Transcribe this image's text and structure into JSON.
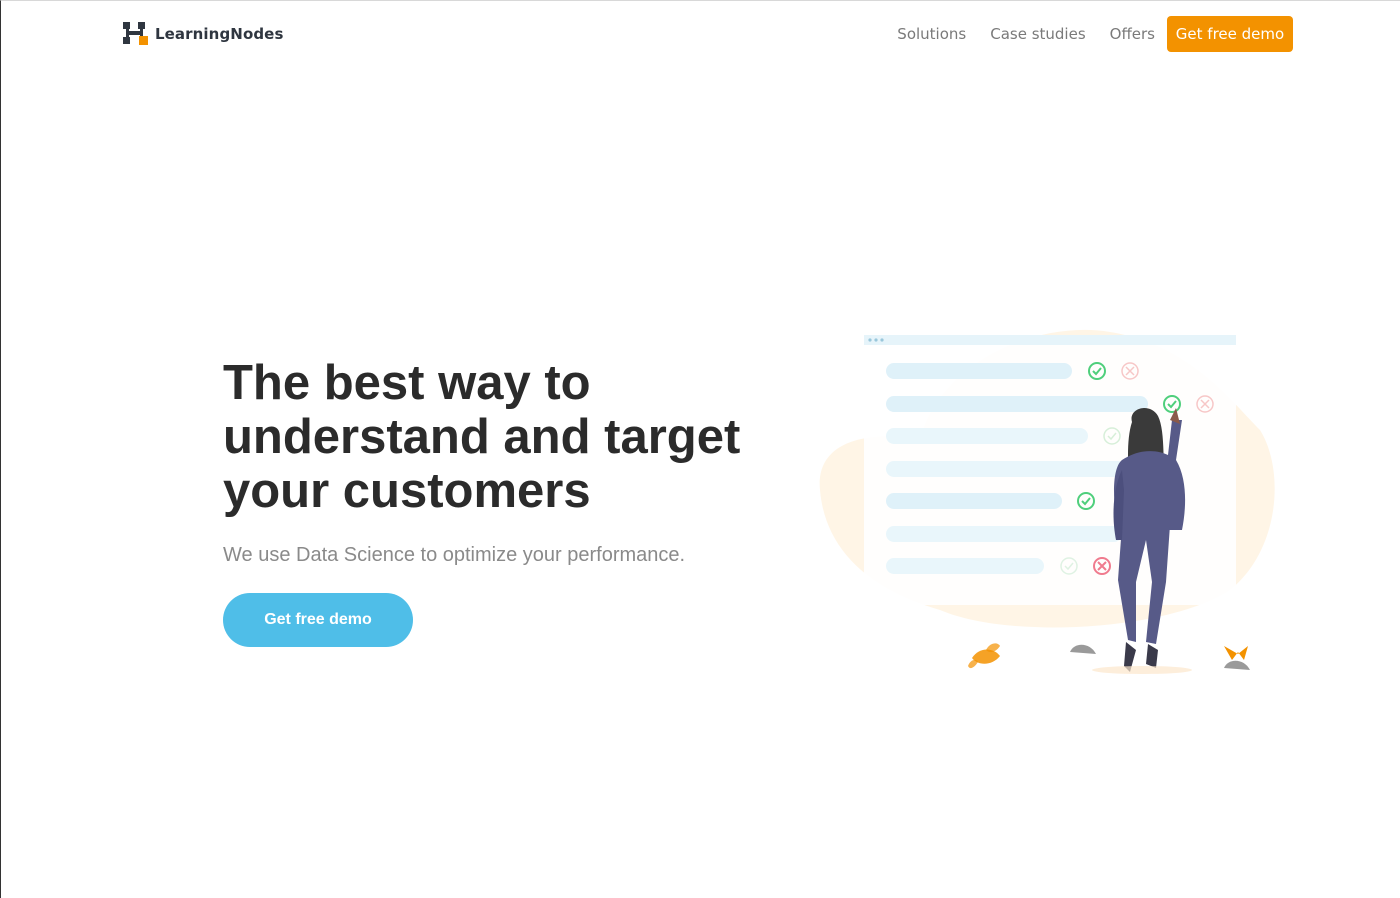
{
  "header": {
    "logo_text": "LearningNodes",
    "nav": [
      {
        "label": "Solutions"
      },
      {
        "label": "Case studies"
      },
      {
        "label": "Offers"
      }
    ],
    "cta_label": "Get free demo"
  },
  "hero": {
    "title_lines": [
      "The best way to",
      "understand and target",
      "your customers"
    ],
    "subtitle": "We use Data Science to optimize your performance.",
    "cta_label": "Get free demo"
  },
  "colors": {
    "accent_orange": "#f39200",
    "accent_blue": "#4fbee8",
    "heading": "#2b2b2b",
    "muted": "#8a8a8a"
  },
  "icons": [
    "logo-mark-icon",
    "check-icon",
    "cross-icon",
    "leaf-icon",
    "rock-icon"
  ]
}
